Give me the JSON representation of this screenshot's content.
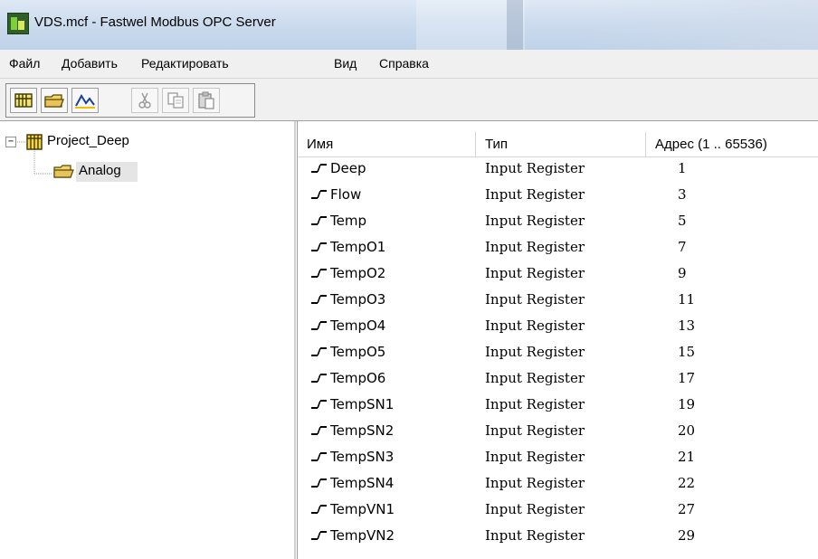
{
  "window": {
    "title": "VDS.mcf - Fastwel Modbus OPC Server"
  },
  "menu": [
    "Файл",
    "Добавить",
    "Редактировать",
    "Вид",
    "Справка"
  ],
  "toolbar": {
    "buttons": [
      {
        "icon": "add-device-icon",
        "enabled": true
      },
      {
        "icon": "add-group-icon",
        "enabled": true
      },
      {
        "icon": "add-tag-icon",
        "enabled": true
      },
      {
        "icon": "cut-icon",
        "enabled": false
      },
      {
        "icon": "copy-icon",
        "enabled": false
      },
      {
        "icon": "paste-icon",
        "enabled": false
      }
    ]
  },
  "tree": {
    "root": {
      "label": "Project_Deep",
      "expander": "⊟"
    },
    "children": [
      {
        "label": "Analog",
        "selected": true
      }
    ]
  },
  "table": {
    "columns": [
      "Имя",
      "Тип",
      "Адрес (1 .. 65536)"
    ],
    "rows": [
      {
        "name": "Deep",
        "type": "Input Register",
        "address": "1"
      },
      {
        "name": "Flow",
        "type": "Input Register",
        "address": "3"
      },
      {
        "name": "Temp",
        "type": "Input Register",
        "address": "5"
      },
      {
        "name": "TempO1",
        "type": "Input Register",
        "address": "7"
      },
      {
        "name": "TempO2",
        "type": "Input Register",
        "address": "9"
      },
      {
        "name": "TempO3",
        "type": "Input Register",
        "address": "11"
      },
      {
        "name": "TempO4",
        "type": "Input Register",
        "address": "13"
      },
      {
        "name": "TempO5",
        "type": "Input Register",
        "address": "15"
      },
      {
        "name": "TempO6",
        "type": "Input Register",
        "address": "17"
      },
      {
        "name": "TempSN1",
        "type": "Input Register",
        "address": "19"
      },
      {
        "name": "TempSN2",
        "type": "Input Register",
        "address": "20"
      },
      {
        "name": "TempSN3",
        "type": "Input Register",
        "address": "21"
      },
      {
        "name": "TempSN4",
        "type": "Input Register",
        "address": "22"
      },
      {
        "name": "TempVN1",
        "type": "Input Register",
        "address": "27"
      },
      {
        "name": "TempVN2",
        "type": "Input Register",
        "address": "29"
      }
    ]
  },
  "colors": {
    "titlebar": "#cddcee",
    "chrome": "#f0f0f0",
    "selection": "#e5e5e5",
    "folder": "#e8c25a",
    "device_icon": "#c9a21a"
  }
}
